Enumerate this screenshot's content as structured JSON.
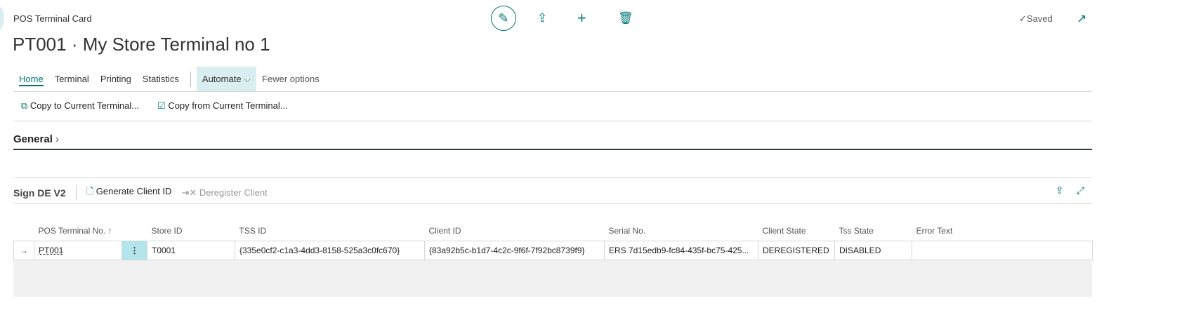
{
  "header": {
    "caption": "POS Terminal Card",
    "title": "PT001 · My Store Terminal no 1",
    "saved": "Saved"
  },
  "tabs": [
    {
      "label": "Home"
    },
    {
      "label": "Terminal"
    },
    {
      "label": "Printing"
    },
    {
      "label": "Statistics"
    },
    {
      "label": "Automate"
    },
    {
      "label": "Fewer options"
    }
  ],
  "actions": {
    "copy_to": "Copy to Current Terminal...",
    "copy_from": "Copy from Current Terminal..."
  },
  "general": {
    "label": "General"
  },
  "subpage": {
    "title": "Sign DE V2",
    "generate": "Generate Client ID",
    "deregister": "Deregister Client"
  },
  "table": {
    "columns": [
      "POS Terminal No. ↑",
      "Store ID",
      "TSS ID",
      "Client ID",
      "Serial No.",
      "Client State",
      "Tss State",
      "Error Text"
    ],
    "rows": [
      {
        "pos": "PT001",
        "store": "T0001",
        "tss": "{335e0cf2-c1a3-4dd3-8158-525a3c0fc670}",
        "client": "{83a92b5c-b1d7-4c2c-9f6f-7f92bc8739f9}",
        "serial": "ERS 7d15edb9-fc84-435f-bc75-425...",
        "client_state": "DEREGISTERED",
        "tss_state": "DISABLED",
        "error": ""
      }
    ]
  }
}
